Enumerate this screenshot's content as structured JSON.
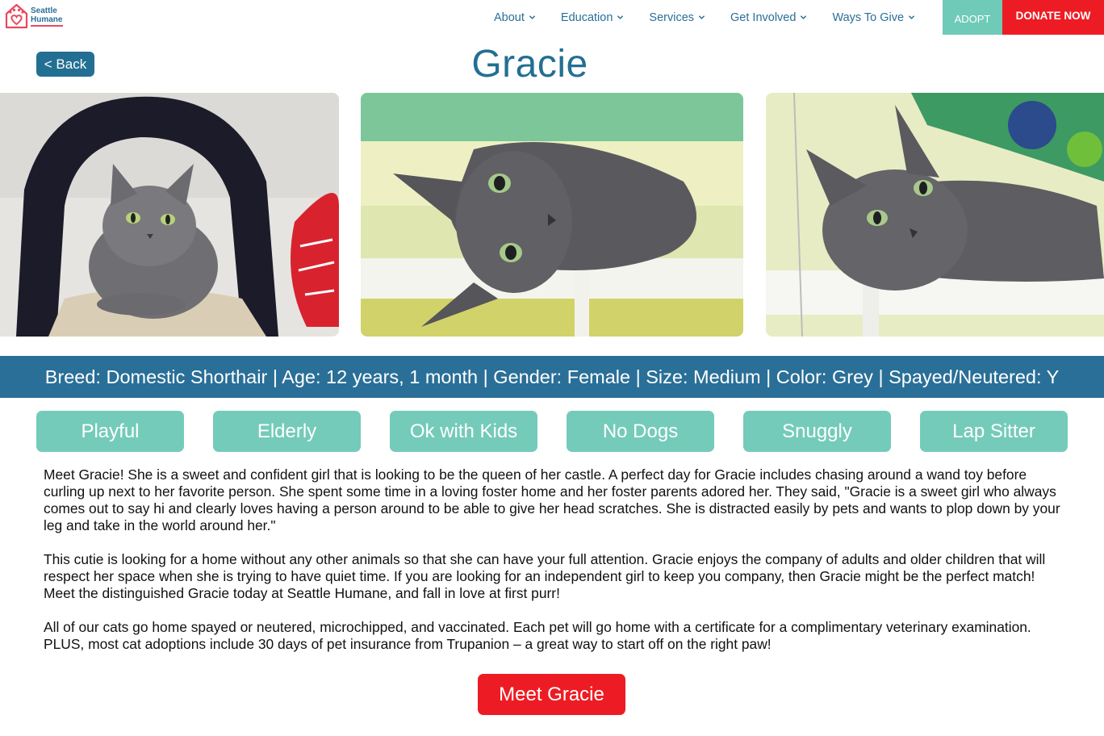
{
  "header": {
    "logo_line1": "Seattle",
    "logo_line2": "Humane",
    "nav": [
      {
        "label": "About",
        "icon": "chevron-down-icon"
      },
      {
        "label": "Education",
        "icon": "chevron-down-icon"
      },
      {
        "label": "Services",
        "icon": "chevron-down-icon"
      },
      {
        "label": "Get Involved",
        "icon": "chevron-down-icon"
      },
      {
        "label": "Ways To Give",
        "icon": "chevron-down-icon"
      }
    ],
    "adopt_label": "ADOPT",
    "donate_label": "DONATE NOW"
  },
  "back_label": "< Back",
  "pet_name": "Gracie",
  "info_bar": "Breed: Domestic Shorthair | Age: 12 years, 1 month | Gender: Female | Size: Medium | Color: Grey | Spayed/Neutered: Y",
  "traits": [
    "Playful",
    "Elderly",
    "Ok with Kids",
    "No Dogs",
    "Snuggly",
    "Lap Sitter"
  ],
  "description": [
    "Meet Gracie! She is a sweet and confident girl that is looking to be the queen of her castle. A perfect day for Gracie includes chasing around a wand toy before curling up next to her favorite person. She spent some time in a loving foster home and her foster parents adored her. They said, \"Gracie is a sweet girl who always comes out to say hi and clearly loves having a person around to be able to give her head scratches. She is distracted easily by pets and wants to plop down by your leg and take in the world around her.\"",
    "This cutie is looking for a home without any other animals so that she can have your full attention. Gracie enjoys the company of adults and older children that will respect her space when she is trying to have quiet time. If you are looking for an independent girl to keep you company, then Gracie might be the perfect match! Meet the distinguished Gracie today at Seattle Humane, and fall in love at first purr!",
    "All of our cats go home spayed or neutered, microchipped, and vaccinated. Each pet will go home with a certificate for a complimentary veterinary examination. PLUS, most cat adoptions include 30 days of pet insurance from Trupanion – a great way to start off on the right paw!"
  ],
  "cta_label": "Meet Gracie",
  "colors": {
    "brand_blue": "#2a6f97",
    "title_blue": "#236f93",
    "trait_teal": "#74cbb9",
    "adopt_teal": "#6fcab8",
    "donate_red": "#ed1c24"
  }
}
